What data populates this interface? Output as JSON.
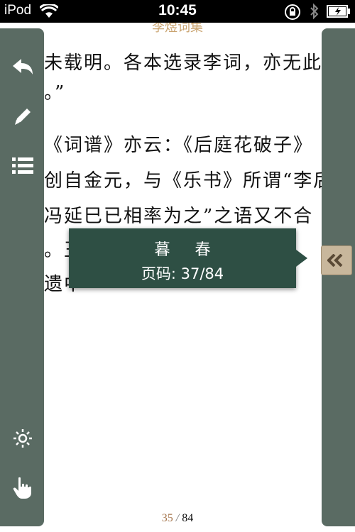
{
  "status_bar": {
    "carrier": "iPod",
    "time": "10:45"
  },
  "reader": {
    "chapter_header": "李煜词集",
    "lines": [
      "未载明。各本选录李词，亦无此",
      "。”",
      "《词谱》亦云：《后庭花破子》",
      "创自金元，与《乐书》所谓“李后",
      "冯延巳已相率为之”之语又不合",
      "。王",
      "遗中"
    ],
    "page_current": "35",
    "page_separator": "/",
    "page_total": "84"
  },
  "tooltip": {
    "chapter_title": "暮 春",
    "page_label": "页码:",
    "page_value": "37/84"
  },
  "colors": {
    "toolbar": "#5a6b63",
    "tooltip": "#2e4f44",
    "expand_button": "#c8b79c",
    "accent": "#a6774f"
  },
  "icons": {
    "left_toolbar": [
      "back-arrow-icon",
      "pencil-icon",
      "list-icon",
      "brightness-icon",
      "hand-pointer-icon"
    ],
    "right_rail": "double-chevron-left-icon"
  }
}
